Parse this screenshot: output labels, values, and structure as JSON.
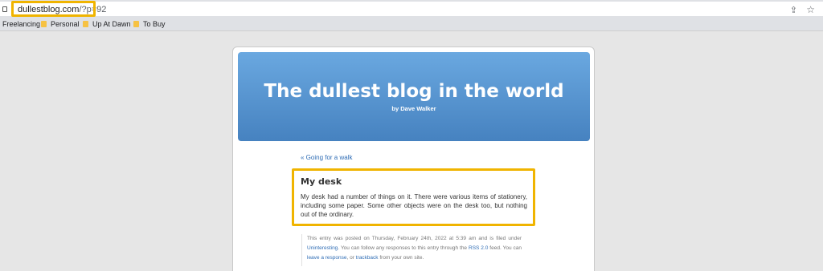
{
  "browser": {
    "url_domain": "dullestblog.com",
    "url_path": "/?p=92"
  },
  "bookmarks": [
    {
      "label": "Freelancing"
    },
    {
      "label": "Personal"
    },
    {
      "label": "Up At Dawn"
    },
    {
      "label": "To Buy"
    }
  ],
  "blog": {
    "title": "The dullest blog in the world",
    "byline": "by Dave Walker"
  },
  "nav": {
    "previous": "« Going for a walk"
  },
  "post": {
    "title": "My desk",
    "body": "My desk had a number of things on it. There were various items of stationery, including some paper. Some other objects were on the desk too, but nothing out of the ordinary."
  },
  "meta": {
    "part1": "This entry was posted on Thursday, February 24th, 2022 at 5:39 am and is filed under ",
    "category": "Uninteresting",
    "part2": ". You can follow any responses to this entry through the ",
    "rss": "RSS 2.0",
    "part3": " feed. You can ",
    "leave_response": "leave a response",
    "part4": ", or ",
    "trackback": "trackback",
    "part5": " from your own site."
  }
}
